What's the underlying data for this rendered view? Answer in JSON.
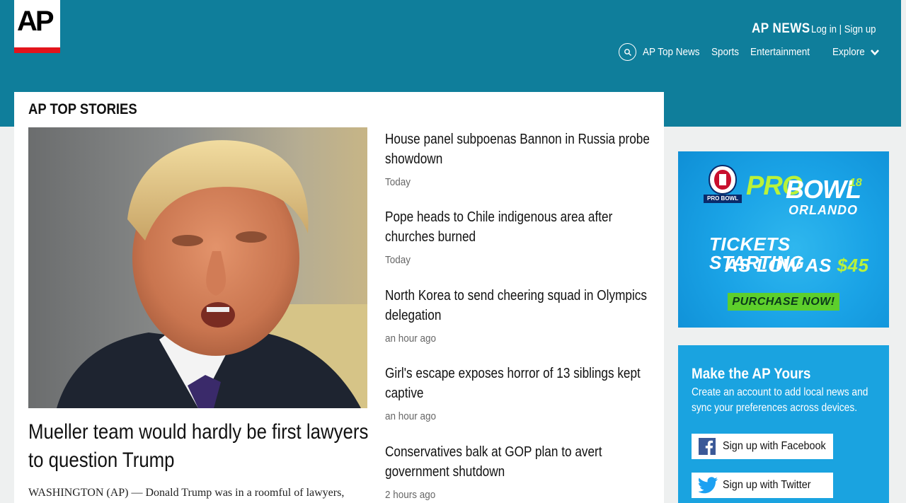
{
  "header": {
    "logo_text": "AP",
    "brand": "AP NEWS",
    "auth": "Log in | Sign up",
    "search_icon": "search-icon",
    "nav": [
      {
        "label": "AP Top News"
      },
      {
        "label": "Sports"
      },
      {
        "label": "Entertainment"
      },
      {
        "label": "Explore"
      }
    ],
    "colors": {
      "band": "#0f7e9b",
      "logo_bar": "#e2141c"
    }
  },
  "main": {
    "section_title": "AP TOP STORIES",
    "lead": {
      "headline": "Mueller team would hardly be first lawyers to question Trump",
      "body": "WASHINGTON (AP) — Donald Trump was in a roomful of lawyers,"
    },
    "stories": [
      {
        "title": "House panel subpoenas Bannon in Russia probe showdown",
        "time": "Today"
      },
      {
        "title": "Pope heads to Chile indigenous area after churches burned",
        "time": "Today"
      },
      {
        "title": "North Korea to send cheering squad in Olympics delegation",
        "time": "an hour ago"
      },
      {
        "title": "Girl's escape exposes horror of 13 siblings kept captive",
        "time": "an hour ago"
      },
      {
        "title": "Conservatives balk at GOP plan to avert government shutdown",
        "time": "2 hours ago"
      }
    ]
  },
  "ad": {
    "logo_caption": "PRO BOWL",
    "pro": "PRO",
    "bowl": "BOWL",
    "year": "18",
    "city": "ORLANDO",
    "line1": "TICKETS STARTING",
    "line2_prefix": "AS LOW AS ",
    "price": "$45",
    "cta": "PURCHASE NOW!"
  },
  "promo": {
    "title": "Make the AP Yours",
    "text": "Create an account to add local news and sync your preferences across devices.",
    "facebook_label": "Sign up with Facebook",
    "twitter_label": "Sign up with Twitter",
    "colors": {
      "panel": "#1aa3e0",
      "facebook": "#3b5998",
      "twitter": "#1da1f2"
    }
  }
}
